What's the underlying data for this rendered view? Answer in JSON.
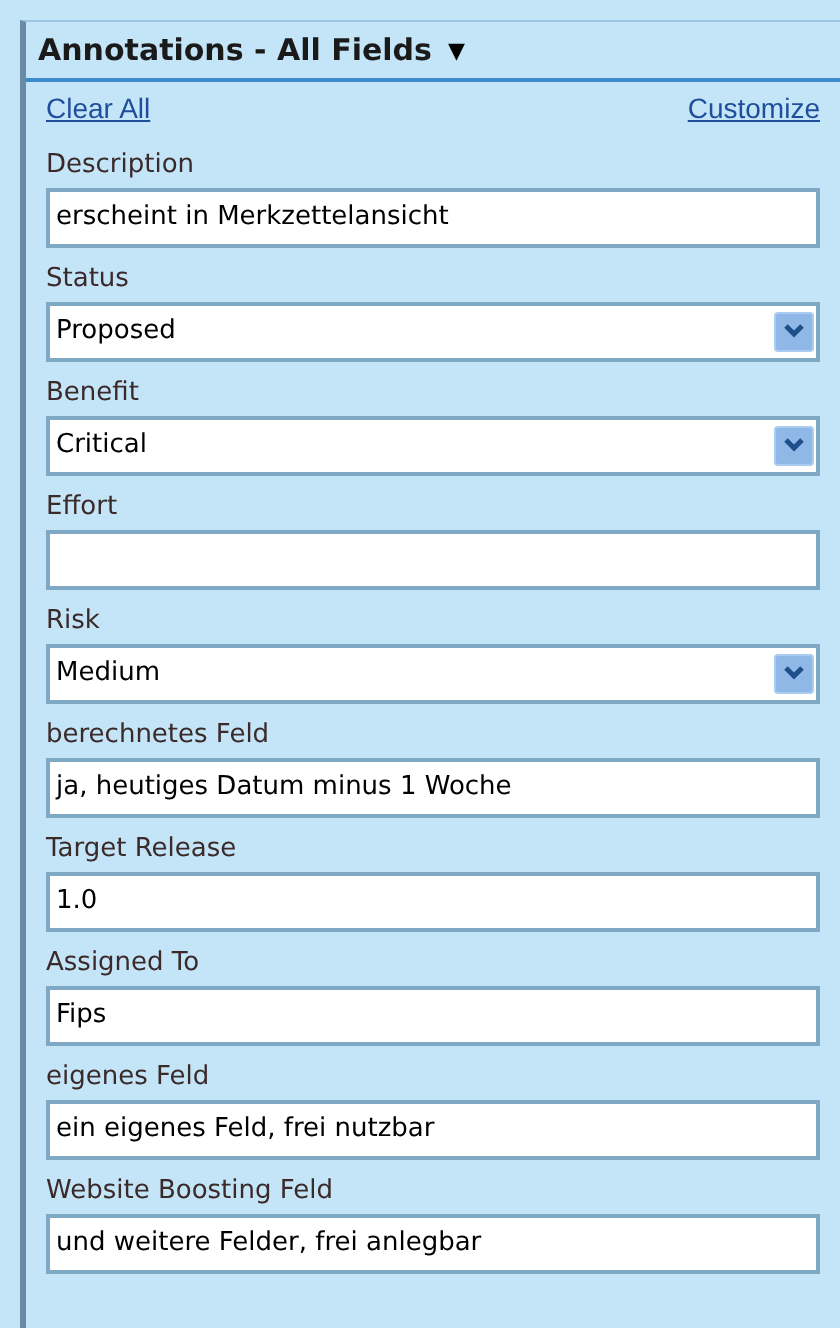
{
  "panel": {
    "title": "Annotations - All Fields",
    "title_menu": "▼",
    "links": [
      "Clear All",
      "Customize"
    ]
  },
  "fields": [
    {
      "label": "Description",
      "kind": "text",
      "value": "erscheint in Merkzettelansicht"
    },
    {
      "label": "Status",
      "kind": "select",
      "value": "Proposed"
    },
    {
      "label": "Benefit",
      "kind": "select",
      "value": "Critical"
    },
    {
      "label": "Effort",
      "kind": "text"
    },
    {
      "label": "Risk",
      "kind": "select",
      "value": "Medium"
    },
    {
      "label": "berechnetes Feld",
      "kind": "text",
      "value": "ja, heutiges Datum minus 1 Woche"
    },
    {
      "label": "Target Release",
      "kind": "text",
      "value": "1.0"
    },
    {
      "label": "Assigned To",
      "kind": "text",
      "value": "Fips"
    },
    {
      "label": "eigenes Feld",
      "kind": "text",
      "value": "ein eigenes Feld, frei nutzbar"
    },
    {
      "label": "Website Boosting Feld",
      "kind": "text",
      "value": "und weitere Felder, frei anlegbar"
    }
  ]
}
